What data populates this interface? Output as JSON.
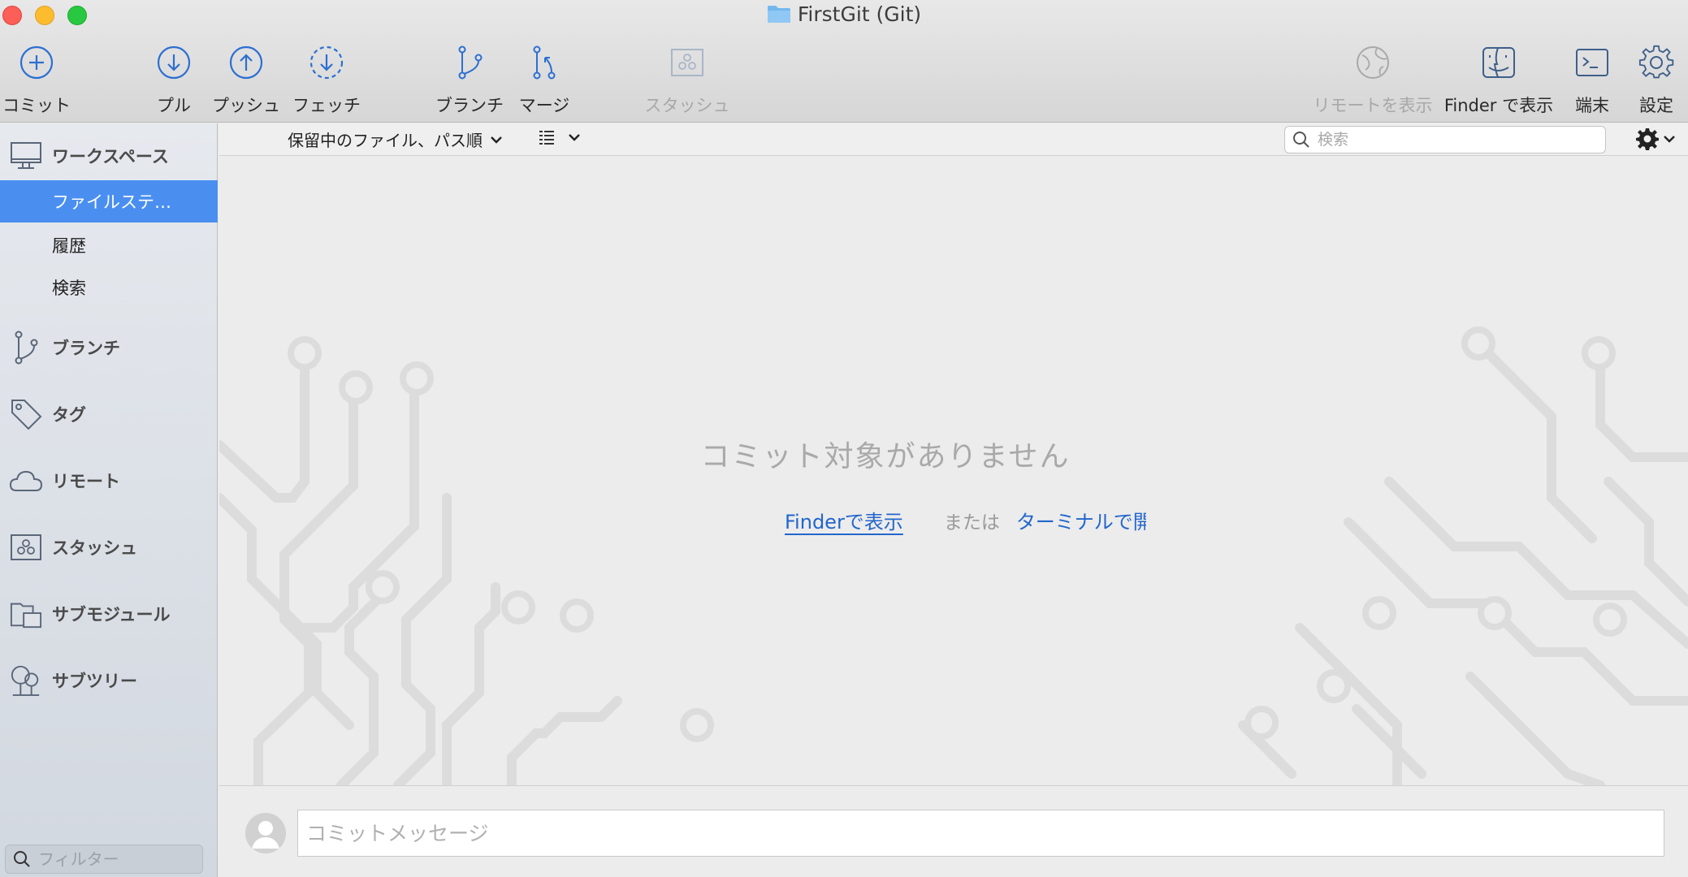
{
  "window": {
    "title": "FirstGit (Git)"
  },
  "toolbar": {
    "commit": "コミット",
    "pull": "プル",
    "push": "プッシュ",
    "fetch": "フェッチ",
    "branch": "ブランチ",
    "merge": "マージ",
    "stash": "スタッシュ",
    "show_remote": "リモートを表示",
    "show_in_finder": "Finder で表示",
    "terminal": "端末",
    "settings": "設定"
  },
  "sidebar": {
    "workspace": "ワークスペース",
    "file_status": "ファイルステ…",
    "history": "履歴",
    "search": "検索",
    "branches": "ブランチ",
    "tags": "タグ",
    "remotes": "リモート",
    "stashes": "スタッシュ",
    "submodules": "サブモジュール",
    "subtrees": "サブツリー",
    "filter_placeholder": "フィルター"
  },
  "subbar": {
    "sort_label": "保留中のファイル、パス順",
    "search_placeholder": "検索"
  },
  "main": {
    "empty_title": "コミット対象がありません",
    "show_in_finder": "Finderで表示",
    "or": "または",
    "open_in_terminal": "ターミナルで開"
  },
  "commit": {
    "placeholder": "コミットメッセージ"
  },
  "colors": {
    "accent_blue": "#2c6fd1",
    "selected_row": "#4a8ff0",
    "close": "#fc5f57",
    "minimize": "#fdbc2e",
    "maximize": "#28c840"
  },
  "icons": {
    "commit": "plus-circle-icon",
    "pull": "arrow-down-circle-icon",
    "push": "arrow-up-circle-icon",
    "fetch": "dashed-arrow-down-circle-icon",
    "branch": "branch-icon",
    "merge": "merge-icon",
    "stash": "stash-icon",
    "show_remote": "globe-icon",
    "finder": "finder-icon",
    "terminal": "terminal-icon",
    "settings": "gear-icon"
  }
}
